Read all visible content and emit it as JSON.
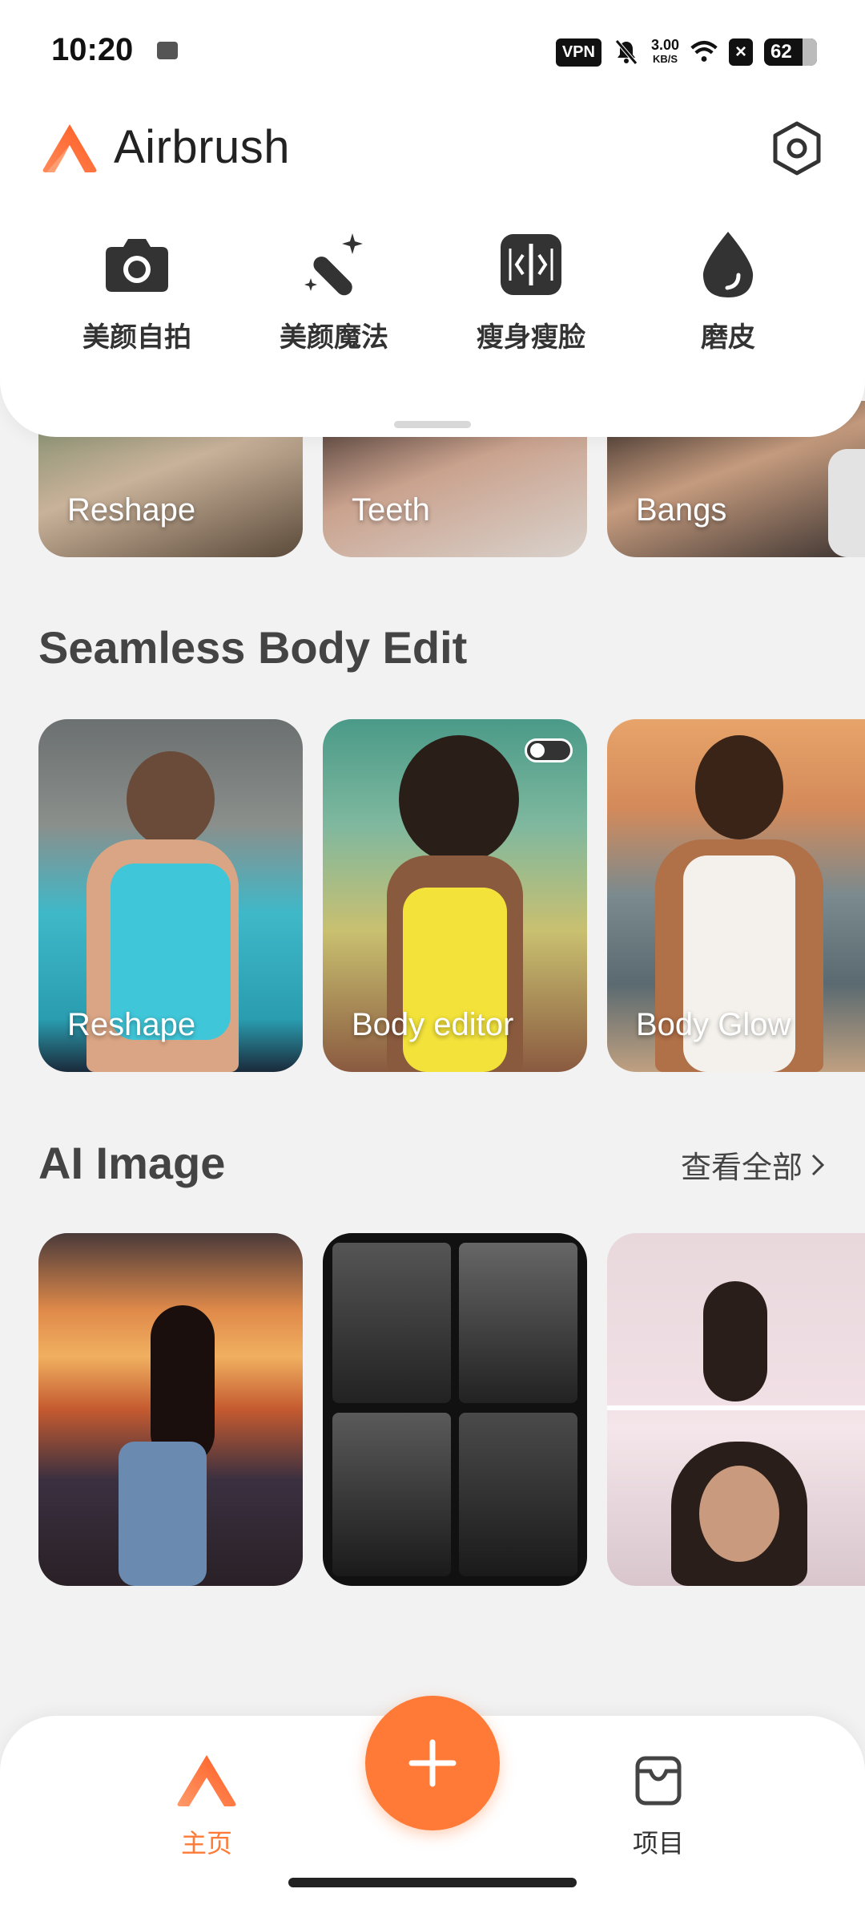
{
  "status_bar": {
    "time": "10:20",
    "vpn": "VPN",
    "speed_value": "3.00",
    "speed_unit": "KB/S",
    "battery": "62"
  },
  "app": {
    "name": "Airbrush",
    "accent_color": "#ff7a36"
  },
  "tools": [
    {
      "label": "美颜自拍",
      "icon": "camera-icon"
    },
    {
      "label": "美颜魔法",
      "icon": "magic-wand-icon"
    },
    {
      "label": "瘦身瘦脸",
      "icon": "slim-body-icon"
    },
    {
      "label": "磨皮",
      "icon": "droplet-icon"
    }
  ],
  "face_row": {
    "items": [
      {
        "label": "Reshape"
      },
      {
        "label": "Teeth"
      },
      {
        "label": "Bangs"
      }
    ]
  },
  "body_section": {
    "title": "Seamless Body Edit",
    "items": [
      {
        "label": "Reshape"
      },
      {
        "label": "Body editor"
      },
      {
        "label": "Body Glow"
      }
    ]
  },
  "ai_section": {
    "title": "AI Image",
    "view_all": "查看全部"
  },
  "bottom_nav": {
    "home_label": "主页",
    "projects_label": "项目"
  }
}
